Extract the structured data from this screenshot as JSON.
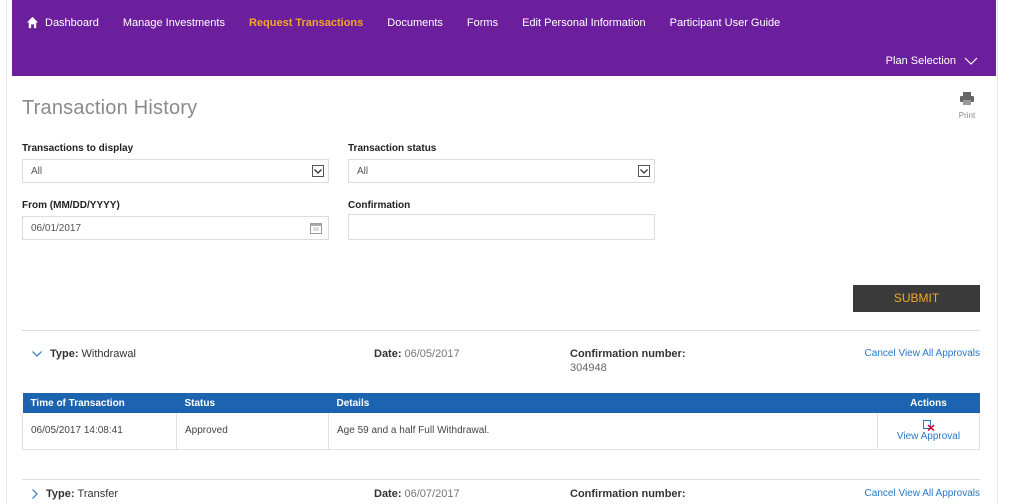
{
  "nav": {
    "items": [
      {
        "label": "Dashboard",
        "active": false
      },
      {
        "label": "Manage Investments",
        "active": false
      },
      {
        "label": "Request Transactions",
        "active": true
      },
      {
        "label": "Documents",
        "active": false
      },
      {
        "label": "Forms",
        "active": false
      },
      {
        "label": "Edit Personal Information",
        "active": false
      },
      {
        "label": "Participant User Guide",
        "active": false
      }
    ],
    "plan_selection": "Plan Selection",
    "icon": "home-icon"
  },
  "page": {
    "title": "Transaction History",
    "print_label": "Print"
  },
  "filters": {
    "transactions_label": "Transactions to display",
    "transactions_value": "All",
    "status_label": "Transaction status",
    "status_value": "All",
    "from_label": "From (MM/DD/YYYY)",
    "from_value": "06/01/2017",
    "confirmation_label": "Confirmation",
    "confirmation_value": ""
  },
  "submit_label": "SUBMIT",
  "transactions": [
    {
      "type_label": "Type:",
      "type_value": "Withdrawal",
      "date_label": "Date:",
      "date_value": "06/05/2017",
      "conf_label": "Confirmation number:",
      "conf_value": "304948",
      "cancel_label": "Cancel",
      "view_all_label": "View All Approvals",
      "expanded": true
    },
    {
      "type_label": "Type:",
      "type_value": "Transfer",
      "date_label": "Date:",
      "date_value": "06/07/2017",
      "conf_label": "Confirmation number:",
      "cancel_label": "Cancel",
      "view_all_label": "View All Approvals",
      "expanded": false
    }
  ],
  "table": {
    "headers": [
      "Time of Transaction",
      "Status",
      "Details",
      "Actions"
    ],
    "rows": [
      {
        "time": "06/05/2017 14:08:41",
        "status": "Approved",
        "details": "Age 59 and a half Full Withdrawal.",
        "action": "View Approval"
      }
    ]
  },
  "colors": {
    "nav_bg": "#6c1f9c",
    "accent_orange": "#f5a623",
    "table_header": "#1d64b0",
    "link_blue": "#2878c8",
    "button_bg": "#3a3a3a"
  }
}
